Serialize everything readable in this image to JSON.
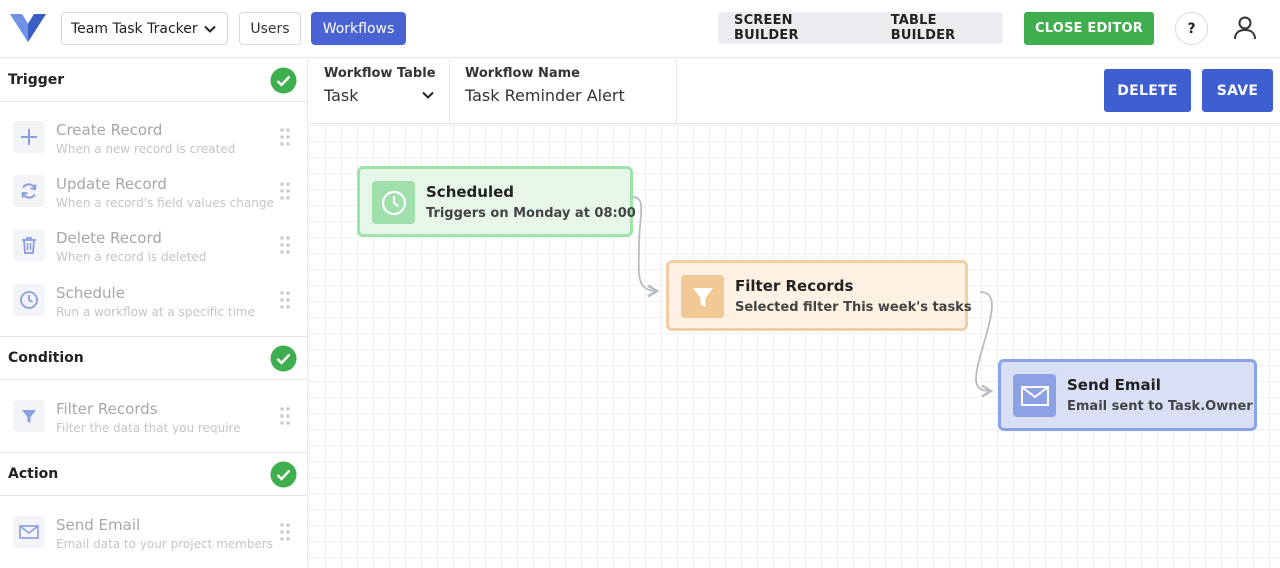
{
  "topbar": {
    "logo_icon": "brand-logo-icon",
    "project_select_value": "Team Task Tracker",
    "users_label": "Users",
    "workflows_label": "Workflows",
    "screen_builder_label": "SCREEN BUILDER",
    "table_builder_label": "TABLE BUILDER",
    "close_editor_label": "CLOSE EDITOR",
    "help_label": "?",
    "accent_color": "#4a63d3",
    "close_color": "#3fae4f"
  },
  "sidebar": {
    "sections": [
      {
        "title": "Trigger",
        "completed": true,
        "items": [
          {
            "title": "Create Record",
            "subtitle": "When a new record is created",
            "icon": "plus-icon"
          },
          {
            "title": "Update Record",
            "subtitle": "When a record's field values change",
            "icon": "refresh-icon"
          },
          {
            "title": "Delete Record",
            "subtitle": "When a record is deleted",
            "icon": "trash-icon"
          },
          {
            "title": "Schedule",
            "subtitle": "Run a workflow at a specific time",
            "icon": "clock-icon"
          }
        ]
      },
      {
        "title": "Condition",
        "completed": true,
        "items": [
          {
            "title": "Filter Records",
            "subtitle": "Filter the data that you require",
            "icon": "filter-icon"
          }
        ]
      },
      {
        "title": "Action",
        "completed": true,
        "items": [
          {
            "title": "Send Email",
            "subtitle": "Email data to your project members",
            "icon": "envelope-icon"
          }
        ]
      }
    ]
  },
  "editor": {
    "workflow_table_label": "Workflow Table",
    "workflow_table_value": "Task",
    "workflow_name_label": "Workflow Name",
    "workflow_name_value": "Task Reminder Alert",
    "delete_label": "DELETE",
    "save_label": "SAVE"
  },
  "canvas": {
    "nodes": [
      {
        "title": "Scheduled",
        "subtitle": "Triggers on Monday at 08:00",
        "icon": "clock-icon",
        "color": "#9ee3a9"
      },
      {
        "title": "Filter Records",
        "subtitle": "Selected filter This week's tasks",
        "icon": "filter-icon",
        "color": "#f2cfa2"
      },
      {
        "title": "Send Email",
        "subtitle": "Email sent to Task.Owner",
        "icon": "envelope-icon",
        "color": "#8aa2e6"
      }
    ]
  }
}
